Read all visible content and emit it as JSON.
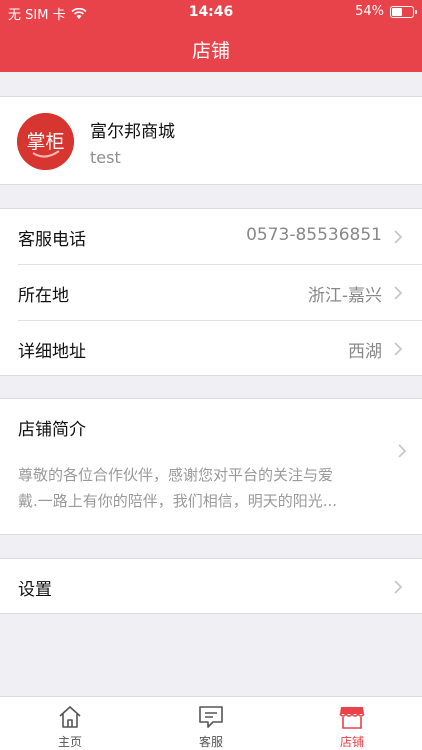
{
  "status_bar": {
    "carrier": "无 SIM 卡",
    "time": "14:46",
    "battery": "54%",
    "battery_level": 0.54
  },
  "header": {
    "title": "店铺"
  },
  "shop": {
    "logo_text": "掌柜",
    "name": "富尔邦商城",
    "subtitle": "test"
  },
  "info": {
    "phone_label": "客服电话",
    "phone_value": "0573-85536851",
    "location_label": "所在地",
    "location_value": "浙江-嘉兴",
    "address_label": "详细地址",
    "address_value": "西湖"
  },
  "intro": {
    "label": "店铺简介",
    "line1": "尊敬的各位合作伙伴，感谢您对平台的关注与爱",
    "line2": "戴.一路上有你的陪伴，我们相信，明天的阳光..."
  },
  "settings": {
    "label": "设置"
  },
  "tabs": [
    {
      "label": "主页",
      "icon": "home-icon"
    },
    {
      "label": "客服",
      "icon": "chat-icon"
    },
    {
      "label": "店铺",
      "icon": "store-icon"
    }
  ],
  "colors": {
    "accent": "#e8434a"
  }
}
